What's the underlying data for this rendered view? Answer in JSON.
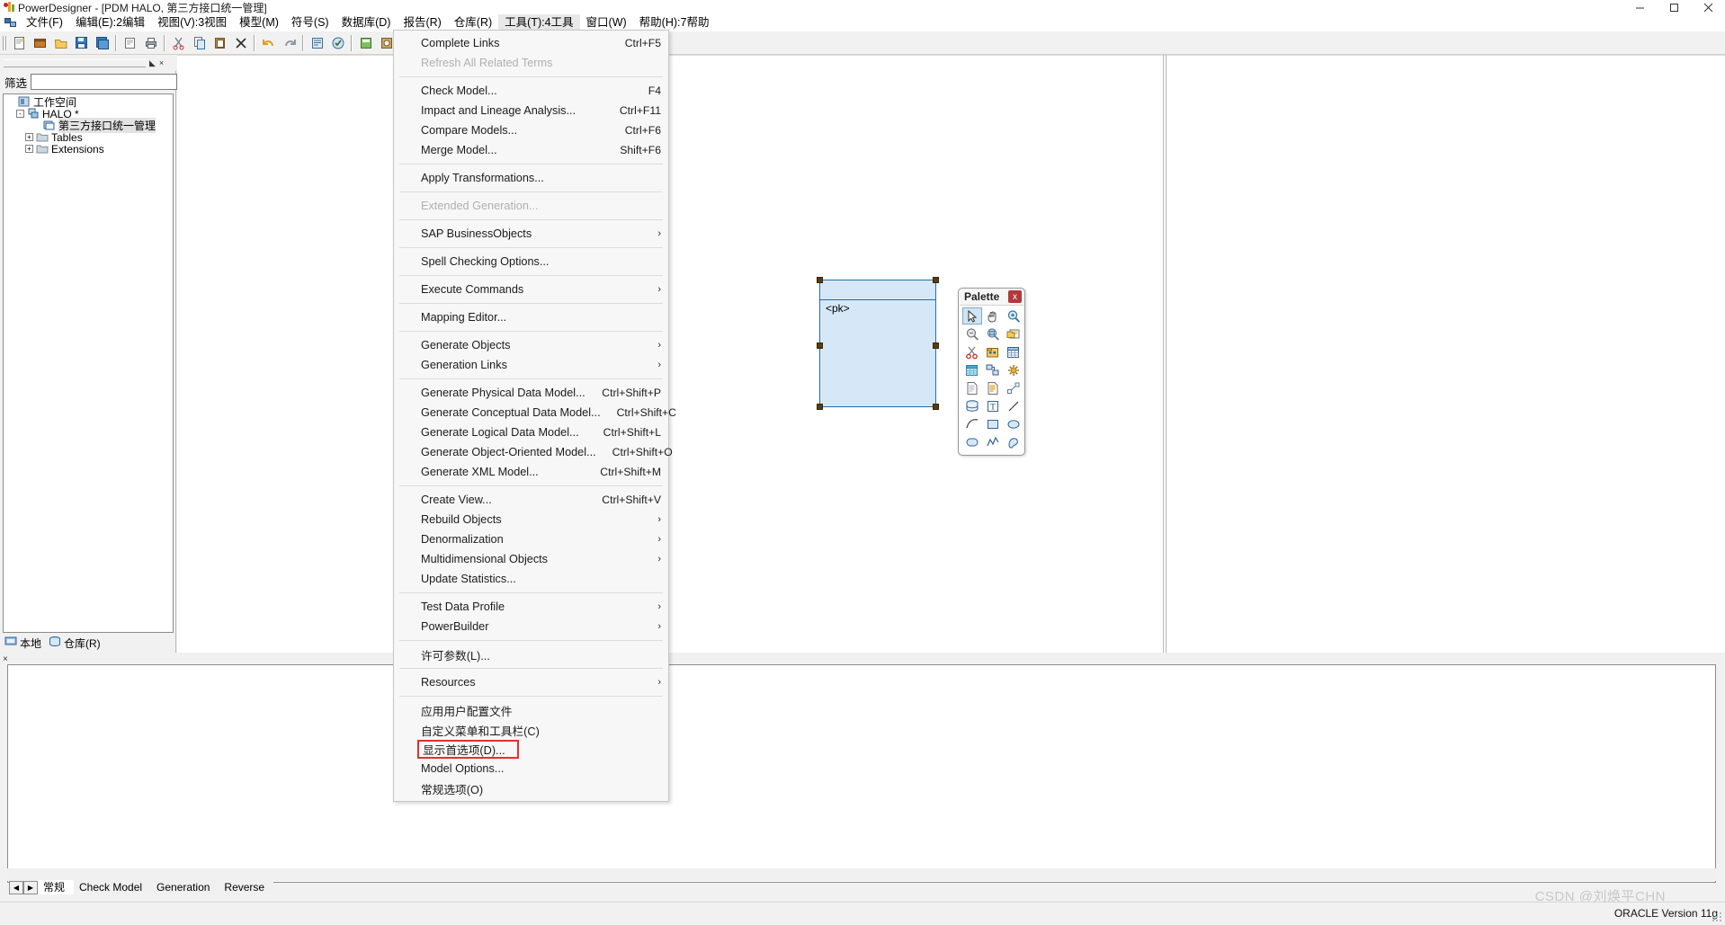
{
  "window": {
    "title": "PowerDesigner - [PDM HALO, 第三方接口统一管理]",
    "minimize": "minimize-icon",
    "maximize": "maximize-icon",
    "close": "close-icon"
  },
  "menubar": {
    "items": [
      {
        "label": "文件(F)",
        "active": false
      },
      {
        "label": "编辑(E):2编辑",
        "active": false
      },
      {
        "label": "视图(V):3视图",
        "active": false
      },
      {
        "label": "模型(M)",
        "active": false
      },
      {
        "label": "符号(S)",
        "active": false
      },
      {
        "label": "数据库(D)",
        "active": false
      },
      {
        "label": "报告(R)",
        "active": false
      },
      {
        "label": "仓库(R)",
        "active": false
      },
      {
        "label": "工具(T):4工具",
        "active": true
      },
      {
        "label": "窗口(W)",
        "active": false
      },
      {
        "label": "帮助(H):7帮助",
        "active": false
      }
    ]
  },
  "tools_menu": {
    "groups": [
      [
        {
          "label": "Complete Links",
          "accel": "Ctrl+F5",
          "disabled": false,
          "submenu": false
        },
        {
          "label": "Refresh All Related Terms",
          "accel": "",
          "disabled": true,
          "submenu": false
        }
      ],
      [
        {
          "label": "Check Model...",
          "accel": "F4",
          "disabled": false,
          "submenu": false
        },
        {
          "label": "Impact and Lineage Analysis...",
          "accel": "Ctrl+F11",
          "disabled": false,
          "submenu": false
        },
        {
          "label": "Compare Models...",
          "accel": "Ctrl+F6",
          "disabled": false,
          "submenu": false
        },
        {
          "label": "Merge Model...",
          "accel": "Shift+F6",
          "disabled": false,
          "submenu": false
        }
      ],
      [
        {
          "label": "Apply Transformations...",
          "accel": "",
          "disabled": false,
          "submenu": false
        }
      ],
      [
        {
          "label": "Extended Generation...",
          "accel": "",
          "disabled": true,
          "submenu": false
        }
      ],
      [
        {
          "label": "SAP BusinessObjects",
          "accel": "",
          "disabled": false,
          "submenu": true
        }
      ],
      [
        {
          "label": "Spell Checking Options...",
          "accel": "",
          "disabled": false,
          "submenu": false
        }
      ],
      [
        {
          "label": "Execute Commands",
          "accel": "",
          "disabled": false,
          "submenu": true
        }
      ],
      [
        {
          "label": "Mapping Editor...",
          "accel": "",
          "disabled": false,
          "submenu": false
        }
      ],
      [
        {
          "label": "Generate Objects",
          "accel": "",
          "disabled": false,
          "submenu": true
        },
        {
          "label": "Generation Links",
          "accel": "",
          "disabled": false,
          "submenu": true
        }
      ],
      [
        {
          "label": "Generate Physical Data Model...",
          "accel": "Ctrl+Shift+P",
          "disabled": false,
          "submenu": false
        },
        {
          "label": "Generate Conceptual Data Model...",
          "accel": "Ctrl+Shift+C",
          "disabled": false,
          "submenu": false
        },
        {
          "label": "Generate Logical Data Model...",
          "accel": "Ctrl+Shift+L",
          "disabled": false,
          "submenu": false
        },
        {
          "label": "Generate Object-Oriented Model...",
          "accel": "Ctrl+Shift+O",
          "disabled": false,
          "submenu": false
        },
        {
          "label": "Generate XML Model...",
          "accel": "Ctrl+Shift+M",
          "disabled": false,
          "submenu": false
        }
      ],
      [
        {
          "label": "Create View...",
          "accel": "Ctrl+Shift+V",
          "disabled": false,
          "submenu": false
        },
        {
          "label": "Rebuild Objects",
          "accel": "",
          "disabled": false,
          "submenu": true
        },
        {
          "label": "Denormalization",
          "accel": "",
          "disabled": false,
          "submenu": true
        },
        {
          "label": "Multidimensional Objects",
          "accel": "",
          "disabled": false,
          "submenu": true
        },
        {
          "label": "Update Statistics...",
          "accel": "",
          "disabled": false,
          "submenu": false
        }
      ],
      [
        {
          "label": "Test Data Profile",
          "accel": "",
          "disabled": false,
          "submenu": true
        },
        {
          "label": "PowerBuilder",
          "accel": "",
          "disabled": false,
          "submenu": true
        }
      ],
      [
        {
          "label": "许可参数(L)...",
          "accel": "",
          "disabled": false,
          "submenu": false
        }
      ],
      [
        {
          "label": "Resources",
          "accel": "",
          "disabled": false,
          "submenu": true
        }
      ],
      [
        {
          "label": "应用用户配置文件",
          "accel": "",
          "disabled": false,
          "submenu": false
        },
        {
          "label": "自定义菜单和工具栏(C)",
          "accel": "",
          "disabled": false,
          "submenu": false
        },
        {
          "label": "显示首选项(D)...",
          "accel": "",
          "disabled": false,
          "submenu": false,
          "highlighted": true
        },
        {
          "label": "Model Options...",
          "accel": "",
          "disabled": false,
          "submenu": false
        },
        {
          "label": "常规选项(O)",
          "accel": "",
          "disabled": false,
          "submenu": false
        }
      ]
    ]
  },
  "browser": {
    "filter_label": "筛选",
    "filter_value": "",
    "filter_placeholder": "",
    "clear_filter_icon": "filter-clear-icon",
    "refresh_icon": "refresh-icon",
    "tree": [
      {
        "label": "工作空间",
        "depth": 0,
        "expander": "",
        "icon": "workspace-icon",
        "selected": false
      },
      {
        "label": "HALO *",
        "depth": 1,
        "expander": "-",
        "icon": "model-icon",
        "selected": false
      },
      {
        "label": "第三方接口统一管理",
        "depth": 2,
        "expander": "",
        "icon": "diagram-icon",
        "selected": true
      },
      {
        "label": "Tables",
        "depth": 2,
        "expander": "+",
        "icon": "folder-icon",
        "selected": false
      },
      {
        "label": "Extensions",
        "depth": 2,
        "expander": "+",
        "icon": "folder-icon",
        "selected": false
      }
    ],
    "tabs": [
      {
        "label": "本地",
        "icon": "local-icon",
        "active": true
      },
      {
        "label": "仓库(R)",
        "icon": "repository-icon",
        "active": false
      }
    ]
  },
  "canvas": {
    "table_symbol": {
      "title": "",
      "rows": [
        "<pk>"
      ]
    }
  },
  "palette": {
    "title": "Palette",
    "close_label": "x",
    "tools": [
      {
        "name": "pointer-icon",
        "selected": true
      },
      {
        "name": "hand-grab-icon",
        "selected": false
      },
      {
        "name": "zoom-in-icon",
        "selected": false
      },
      {
        "name": "zoom-out-icon",
        "selected": false
      },
      {
        "name": "zoom-area-icon",
        "selected": false
      },
      {
        "name": "open-package-icon",
        "selected": false
      },
      {
        "name": "scissors-icon",
        "selected": false
      },
      {
        "name": "package-icon",
        "selected": false
      },
      {
        "name": "table-icon",
        "selected": false
      },
      {
        "name": "view-icon",
        "selected": false
      },
      {
        "name": "reference-icon",
        "selected": false
      },
      {
        "name": "procedure-icon",
        "selected": false
      },
      {
        "name": "file-icon",
        "selected": false
      },
      {
        "name": "note-icon",
        "selected": false
      },
      {
        "name": "link-icon",
        "selected": false
      },
      {
        "name": "database-icon",
        "selected": false
      },
      {
        "name": "text-icon",
        "selected": false
      },
      {
        "name": "line-icon",
        "selected": false
      },
      {
        "name": "arc-icon",
        "selected": false
      },
      {
        "name": "rectangle-icon",
        "selected": false
      },
      {
        "name": "ellipse-icon",
        "selected": false
      },
      {
        "name": "rounded-rect-icon",
        "selected": false
      },
      {
        "name": "polyline-icon",
        "selected": false
      },
      {
        "name": "polygon-icon",
        "selected": false
      }
    ]
  },
  "output": {
    "tabs": [
      {
        "label": "常规",
        "active": true
      },
      {
        "label": "Check Model",
        "active": false
      },
      {
        "label": "Generation",
        "active": false
      },
      {
        "label": "Reverse",
        "active": false
      }
    ],
    "nav_prev": "◀",
    "nav_next": "▶",
    "close_label": "×"
  },
  "statusbar": {
    "right_text": "ORACLE Version 11g"
  },
  "watermark": {
    "text": "CSDN @刘焕平CHN"
  }
}
